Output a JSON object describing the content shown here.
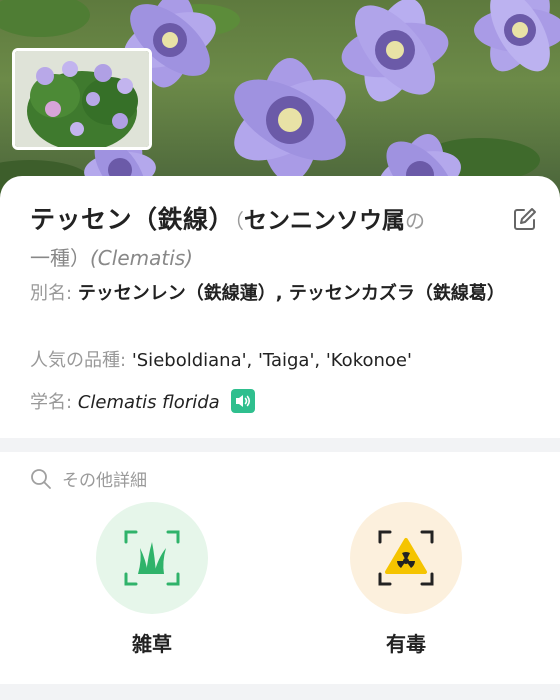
{
  "plant": {
    "name": "テッセン（鉄線）",
    "category_open": "（",
    "category": "センニンソウ属",
    "category_suffix": "の",
    "line2_prefix": "一種）",
    "latin_genus": "(Clematis)"
  },
  "details": {
    "alias_label": "別名:",
    "alias_value": "テッセンレン（鉄線蓮）, テッセンカズラ（鉄線葛）",
    "varieties_label": "人気の品種:",
    "varieties_value": "'Sieboldiana', 'Taiga', 'Kokonoe'",
    "scientific_label": "学名:",
    "scientific_value": "Clematis florida"
  },
  "more": {
    "label": "その他詳細"
  },
  "features": [
    {
      "label": "雑草",
      "icon": "grass-scan-icon",
      "color": "#2fb36a"
    },
    {
      "label": "有毒",
      "icon": "toxic-scan-icon",
      "color": "#f5c400"
    }
  ],
  "colors": {
    "accent": "#2fbf8e",
    "petal": "#a99be6"
  }
}
